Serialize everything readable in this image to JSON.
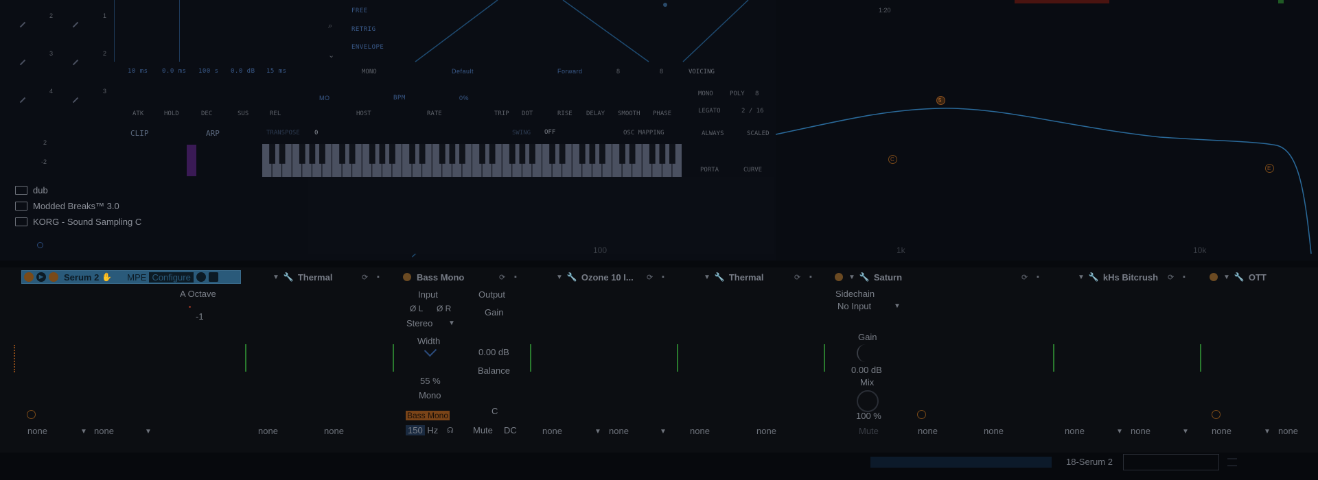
{
  "synth": {
    "side_labels": {
      "free": "FREE",
      "retrig": "RETRIG",
      "envelope": "ENVELOPE"
    },
    "time_display": "1:20",
    "env_values": [
      "10 ms",
      "0.0 ms",
      "100 s",
      "0.0 dB",
      "15 ms"
    ],
    "env_labels": [
      "ATK",
      "HOLD",
      "DEC",
      "SUS",
      "REL"
    ],
    "lfo_mode": "MONO",
    "lfo_preset": "Default",
    "lfo_direction": "Forward",
    "lfo_rate_a": "8",
    "lfo_rate_b": "8",
    "lfo_labels": [
      "HOST",
      "BPM",
      "RATE",
      "TRIP",
      "DOT",
      "RISE",
      "DELAY",
      "SMOOTH",
      "PHASE"
    ],
    "lfo_small": [
      "MO",
      "0%"
    ],
    "voicing": {
      "title": "VOICING",
      "mono": "MONO",
      "poly": "POLY",
      "poly_count": "8",
      "legato": "LEGATO",
      "legato_val": "2 / 16",
      "always": "ALWAYS",
      "scaled": "SCALED",
      "porta": "PORTA",
      "curve": "CURVE"
    },
    "octave_nums": [
      "2",
      "3",
      "4",
      "1",
      "2",
      "3"
    ],
    "clip_label": "CLIP",
    "arp_label": "ARP",
    "transpose_label": "TRANSPOSE",
    "transpose_value": "0",
    "swing_label": "SWING",
    "swing_value": "OFF",
    "osc_mapping_label": "OSC MAPPING",
    "clip_nums": [
      "2",
      "-2"
    ]
  },
  "eq": {
    "freq_labels": [
      "100",
      "1k",
      "10k"
    ],
    "node_labels": [
      "5",
      "C",
      "E"
    ],
    "curve_color": "#2a6a9a"
  },
  "browser": {
    "items": [
      "dub",
      "Modded Breaks™ 3.0",
      "KORG - Sound Sampling C"
    ]
  },
  "devices": {
    "serum": {
      "name": "Serum 2",
      "mpe": "MPE",
      "configure": "Configure",
      "param_label": "A Octave",
      "param_value": "-1"
    },
    "thermal1": {
      "name": "Thermal"
    },
    "bassmono": {
      "name": "Bass Mono",
      "input_label": "Input",
      "output_label": "Output",
      "phase_l": "Ø L",
      "phase_r": "Ø R",
      "stereo": "Stereo",
      "width_label": "Width",
      "width_value": "55 %",
      "mono_label": "Mono",
      "gain_label": "Gain",
      "gain_value": "0.00 dB",
      "balance_label": "Balance",
      "balance_value": "C",
      "badge": "Bass Mono",
      "freq_value": "150",
      "freq_unit": "Hz",
      "mute": "Mute",
      "dc": "DC"
    },
    "ozone": {
      "name": "Ozone 10 I..."
    },
    "thermal2": {
      "name": "Thermal"
    },
    "saturn": {
      "name": "Saturn",
      "sidechain_label": "Sidechain",
      "sidechain_value": "No Input",
      "gain_label": "Gain",
      "gain_value": "0.00 dB",
      "mix_label": "Mix",
      "mix_value": "100 %",
      "mute": "Mute"
    },
    "bitcrush": {
      "name": "kHs Bitcrush"
    },
    "ott": {
      "name": "OTT"
    }
  },
  "macros": [
    "none",
    "none",
    "none",
    "none",
    "none",
    "none",
    "none",
    "none",
    "none",
    "none",
    "none",
    "none",
    "none",
    "none"
  ],
  "status": {
    "track_name": "18-Serum 2"
  },
  "colors": {
    "serum_header": "#2a5a7a",
    "bass_mono_badge": "#c86a2a",
    "meter": "#2a7a2e",
    "accent_blue": "#2a6a9a"
  }
}
